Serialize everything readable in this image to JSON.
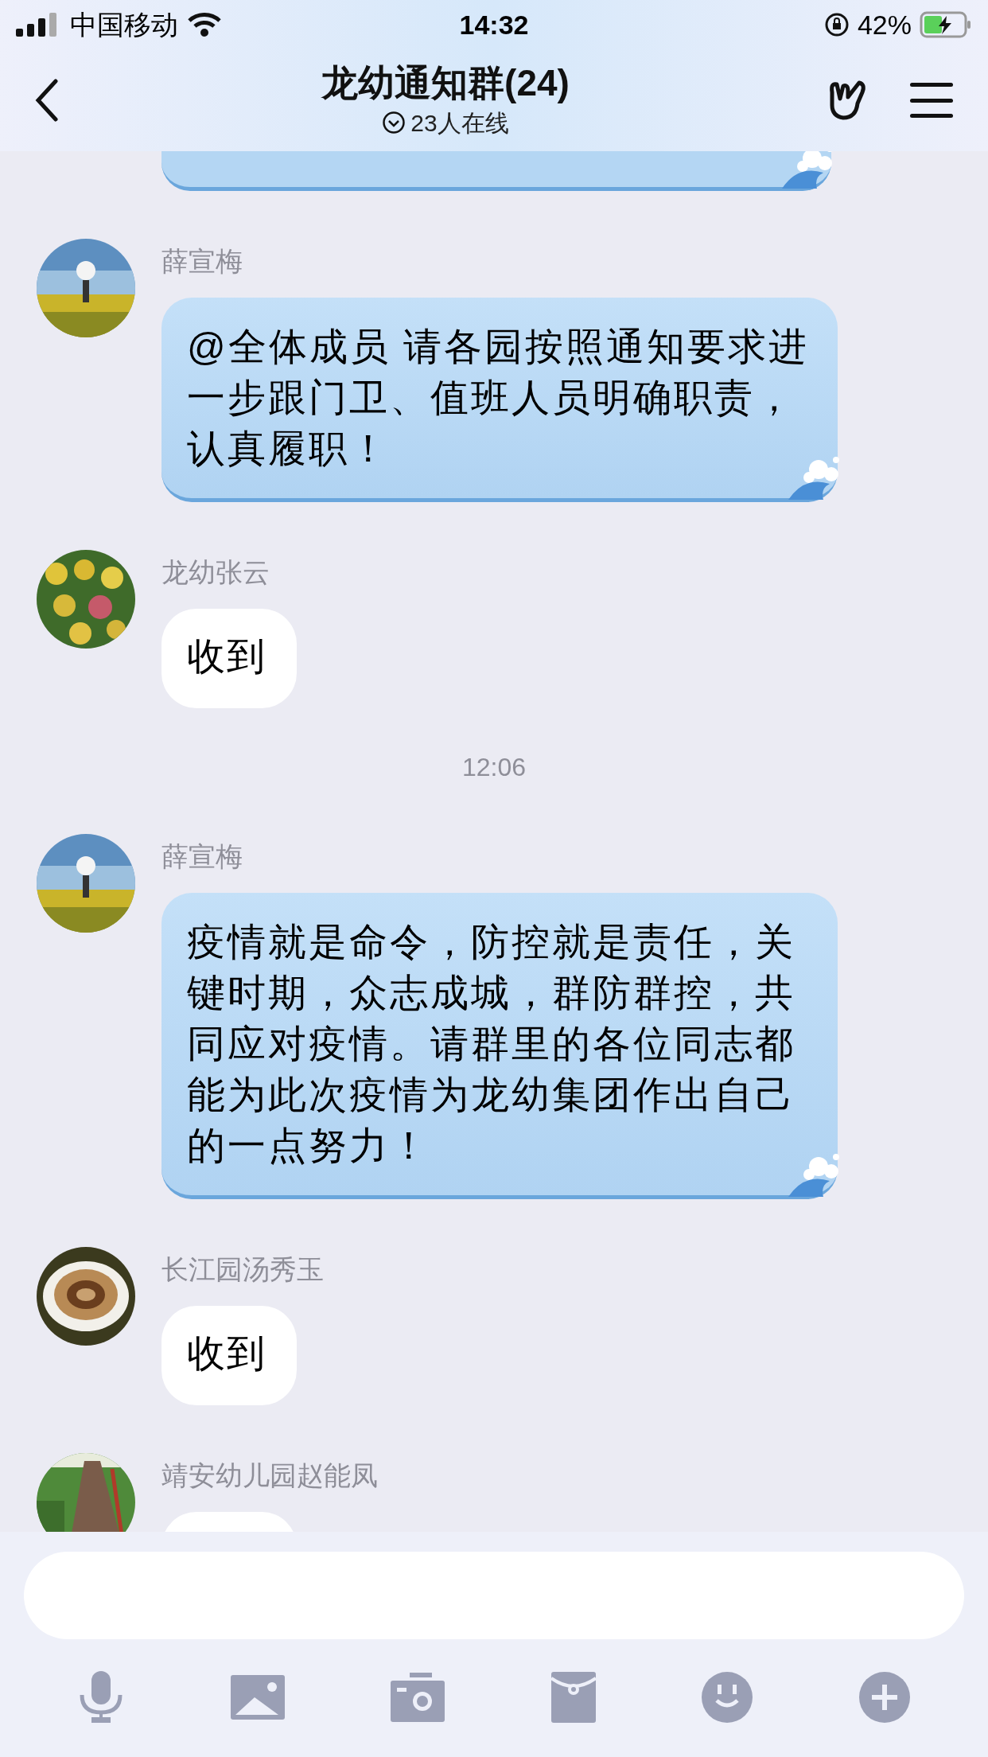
{
  "status_bar": {
    "carrier": "中国移动",
    "time": "14:32",
    "battery": "42%"
  },
  "header": {
    "title": "龙幼通知群(24)",
    "subtitle": "23人在线"
  },
  "messages": [
    {
      "kind": "partial"
    },
    {
      "kind": "themed",
      "sender": "薛宣梅",
      "text": "@全体成员  请各园按照通知要求进一步跟门卫、值班人员明确职责，认真履职！"
    },
    {
      "kind": "plain",
      "sender": "龙幼张云",
      "text": "收到"
    },
    {
      "kind": "time",
      "text": "12:06"
    },
    {
      "kind": "themed",
      "sender": "薛宣梅",
      "text": "疫情就是命令，防控就是责任，关键时期，众志成城，群防群控，共同应对疫情。请群里的各位同志都能为此次疫情为龙幼集团作出自己的一点努力！"
    },
    {
      "kind": "plain",
      "sender": "长江园汤秀玉",
      "text": "收到"
    },
    {
      "kind": "plain",
      "sender": "靖安幼儿园赵能凤"
    }
  ]
}
